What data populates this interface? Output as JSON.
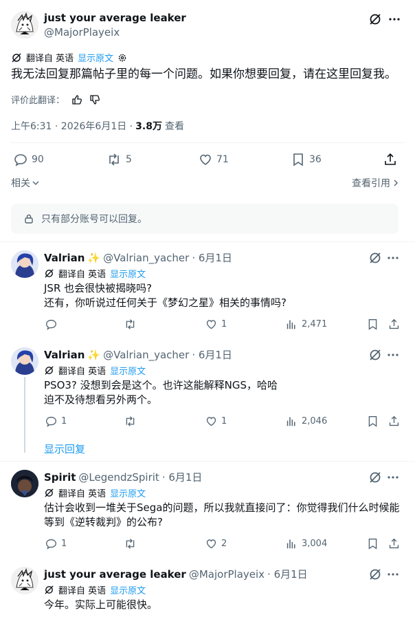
{
  "main_tweet": {
    "display_name": "just your average leaker",
    "handle": "@MajorPlayeix",
    "translated_from": "翻译自 英语",
    "show_original": "显示原文",
    "text": "我无法回复那篇帖子里的每一个问题。如果你想要回复，请在这里回复我。",
    "rate_translation": "评价此翻译：",
    "time": "上午6:31 · 2026年6月1日 ·",
    "views_count": "3.8万",
    "views_label": "查看",
    "replies": "90",
    "retweets": "5",
    "likes": "71",
    "bookmarks": "36",
    "related": "相关",
    "view_quotes": "查看引用"
  },
  "reply_restriction": "只有部分账号可以回复。",
  "replies": [
    {
      "display_name": "Valrian",
      "emoji": "✨",
      "handle": "@Valrian_yacher",
      "date": "· 6月1日",
      "translated_from": "翻译自 英语",
      "show_original": "显示原文",
      "line1": "JSR 也会很快被揭晓吗?",
      "line2": "还有，你听说过任何关于《梦幻之星》相关的事情吗?",
      "replies": "",
      "retweets": "",
      "likes": "1",
      "views": "2,471"
    },
    {
      "display_name": "Valrian",
      "emoji": "✨",
      "handle": "@Valrian_yacher",
      "date": "· 6月1日",
      "translated_from": "翻译自 英语",
      "show_original": "显示原文",
      "line1": "PSO3? 没想到会是这个。也许这能解释NGS，哈哈",
      "line2": "迫不及待想看另外两个。",
      "replies": "1",
      "retweets": "",
      "likes": "1",
      "views": "2,046"
    },
    {
      "display_name": "Spirit",
      "handle": "@LegendzSpirit",
      "date": "· 6月1日",
      "translated_from": "翻译自 英语",
      "show_original": "显示原文",
      "line1": "估计会收到一堆关于Sega的问题，所以我就直接问了：你觉得我们什么时候能",
      "line2": "等到《逆转裁判》的公布?",
      "replies": "1",
      "retweets": "",
      "likes": "2",
      "views": "3,004"
    },
    {
      "display_name": "just your average leaker",
      "handle": "@MajorPlayeix",
      "date": "· 6月1日",
      "translated_from": "翻译自 英语",
      "show_original": "显示原文",
      "line1": "今年。实际上可能很快。"
    }
  ],
  "show_replies": "显示回复",
  "colors": {
    "accent": "#1d9bf0",
    "text": "#0f1419",
    "secondary": "#536471",
    "divider": "#eff3f4"
  }
}
